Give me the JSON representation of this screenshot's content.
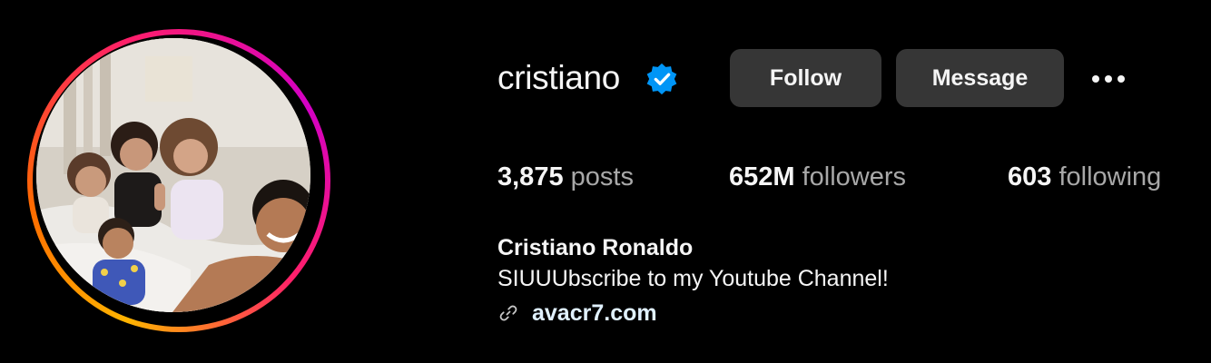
{
  "profile": {
    "username": "cristiano",
    "verified_icon": "verified-badge-icon",
    "full_name": "Cristiano Ronaldo",
    "bio": "SIUUUbscribe to my Youtube Channel!",
    "link_icon": "link-icon",
    "link": "avacr7.com"
  },
  "actions": {
    "follow_label": "Follow",
    "message_label": "Message",
    "more_icon": "more-options-icon"
  },
  "stats": {
    "posts": {
      "value": "3,875",
      "label": "posts"
    },
    "followers": {
      "value": "652M",
      "label": "followers"
    },
    "following": {
      "value": "603",
      "label": "following"
    }
  },
  "colors": {
    "background": "#000000",
    "button_bg": "#363636",
    "text_primary": "#f5f5f5",
    "text_secondary": "#a8a8a8",
    "link": "#e0f1ff",
    "verified_blue": "#0095f6",
    "story_ring_start": "#ffb400",
    "story_ring_end": "#d300c5"
  }
}
